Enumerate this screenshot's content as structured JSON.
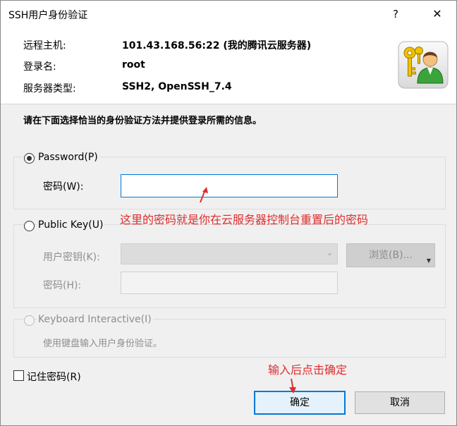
{
  "window": {
    "title": "SSH用户身份验证",
    "help_glyph": "?",
    "close_glyph": "✕"
  },
  "info": {
    "host_label": "远程主机:",
    "host_value": "101.43.168.56:22 (我的腾讯云服务器)",
    "login_label": "登录名:",
    "login_value": "root",
    "server_type_label": "服务器类型:",
    "server_type_value": "SSH2, OpenSSH_7.4"
  },
  "instruction": "请在下面选择恰当的身份验证方法并提供登录所需的信息。",
  "password_section": {
    "radio_label": "Password(P)",
    "field_label": "密码(W):",
    "value": ""
  },
  "publickey_section": {
    "radio_label": "Public Key(U)",
    "user_key_label": "用户密钥(K):",
    "browse_label": "浏览(B)...",
    "passphrase_label": "密码(H):"
  },
  "keyboard_section": {
    "radio_label": "Keyboard Interactive(I)",
    "description": "使用键盘输入用户身份验证。"
  },
  "remember": {
    "label": "记住密码(R)"
  },
  "buttons": {
    "ok": "确定",
    "cancel": "取消"
  },
  "annotations": {
    "password_note": "这里的密码就是你在云服务器控制台重置后的密码",
    "ok_note": "输入后点击确定",
    "color": "#e02d2d"
  },
  "icons": {
    "avatar": "user-key-icon"
  }
}
